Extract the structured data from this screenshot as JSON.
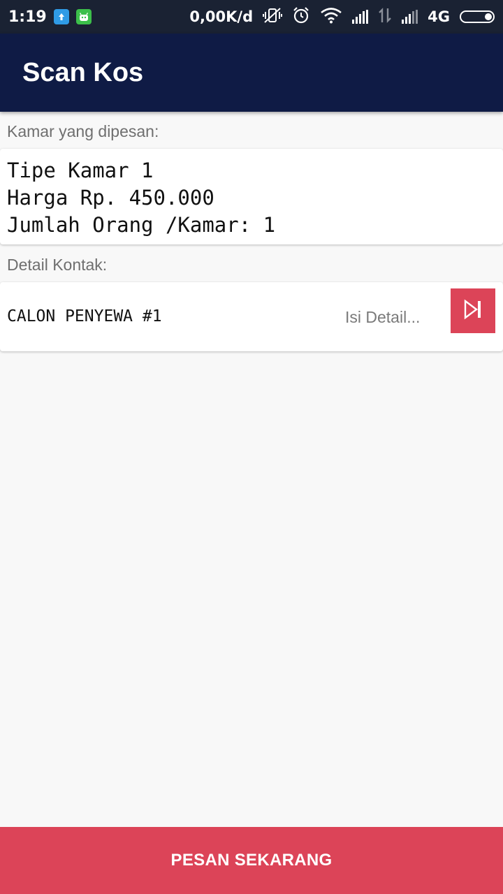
{
  "status_bar": {
    "time": "1:19",
    "speed": "0,00K/d",
    "network": "4G"
  },
  "app_bar": {
    "title": "Scan Kos"
  },
  "room_section": {
    "label": "Kamar yang dipesan:",
    "room_type": "Tipe Kamar 1",
    "price": "Harga Rp. 450.000",
    "persons": "Jumlah Orang /Kamar: 1"
  },
  "contact_section": {
    "label": "Detail Kontak:",
    "tenant_name": "CALON PENYEWA #1",
    "detail_placeholder": "Isi Detail..."
  },
  "footer": {
    "order_label": "PESAN SEKARANG"
  },
  "colors": {
    "app_bar": "#0f1b45",
    "accent": "#dc4458",
    "background": "#f8f8f8"
  }
}
